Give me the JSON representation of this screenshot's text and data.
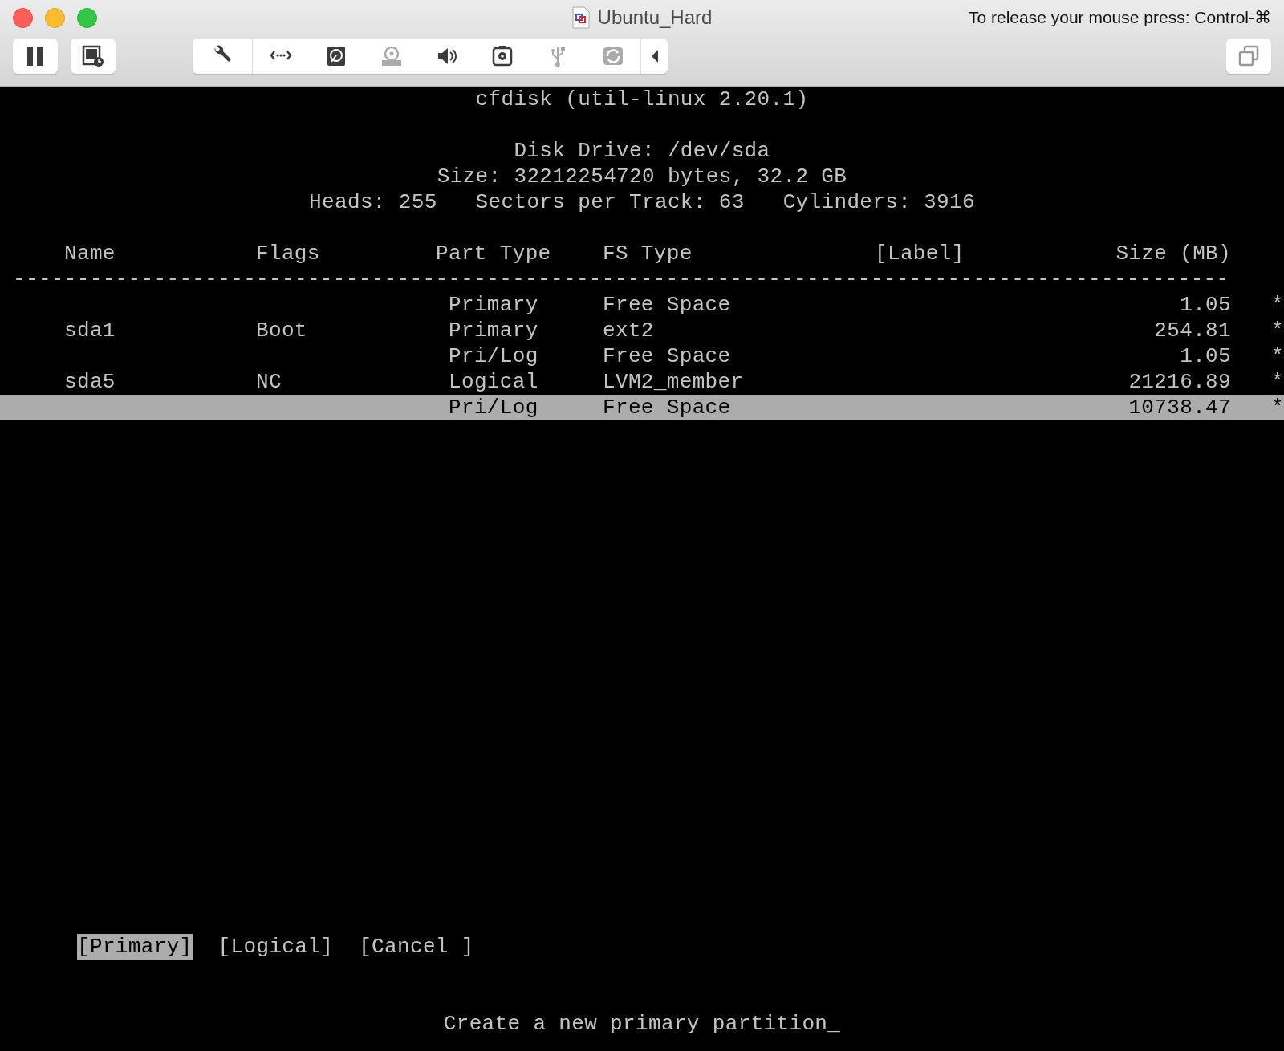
{
  "window": {
    "title": "Ubuntu_Hard",
    "release_hint": "To release your mouse press: Control-⌘"
  },
  "toolbar": [
    {
      "kind": "wrench",
      "disabled": false
    },
    {
      "kind": "network",
      "disabled": false
    },
    {
      "kind": "disk",
      "disabled": false
    },
    {
      "kind": "optical",
      "disabled": true
    },
    {
      "kind": "sound",
      "disabled": false
    },
    {
      "kind": "camera",
      "disabled": false
    },
    {
      "kind": "usb",
      "disabled": true
    },
    {
      "kind": "sharing",
      "disabled": true
    }
  ],
  "terminal": {
    "title": "cfdisk (util-linux 2.20.1)",
    "disk_info": [
      "Disk Drive: /dev/sda",
      "Size: 32212254720 bytes, 32.2 GB"
    ],
    "geometry": [
      "Heads: 255",
      "Sectors per Track: 63",
      "Cylinders: 3916"
    ],
    "table": {
      "columns": [
        "Name",
        "Flags",
        "Part Type",
        "FS Type",
        "[Label]",
        "Size (MB)"
      ],
      "separator": "-----------------------------------------------------------------------------------------------",
      "rows": [
        {
          "name": "",
          "flags": "",
          "part_type": "Primary",
          "fs_type": "Free Space",
          "label": "",
          "size": "1.05",
          "mark": "*",
          "selected": false
        },
        {
          "name": "sda1",
          "flags": "Boot",
          "part_type": "Primary",
          "fs_type": "ext2",
          "label": "",
          "size": "254.81",
          "mark": "*",
          "selected": false
        },
        {
          "name": "",
          "flags": "",
          "part_type": "Pri/Log",
          "fs_type": "Free Space",
          "label": "",
          "size": "1.05",
          "mark": "*",
          "selected": false
        },
        {
          "name": "sda5",
          "flags": "NC",
          "part_type": "Logical",
          "fs_type": "LVM2_member",
          "label": "",
          "size": "21216.89",
          "mark": "*",
          "selected": false
        },
        {
          "name": "",
          "flags": "",
          "part_type": "Pri/Log",
          "fs_type": "Free Space",
          "label": "",
          "size": "10738.47",
          "mark": "*",
          "selected": true
        }
      ]
    },
    "buttons": [
      {
        "label": "[Primary]",
        "selected": true
      },
      {
        "label": "[Logical]",
        "selected": false
      },
      {
        "label": "[Cancel ]",
        "selected": false
      }
    ],
    "message": "Create a new primary partition_"
  }
}
